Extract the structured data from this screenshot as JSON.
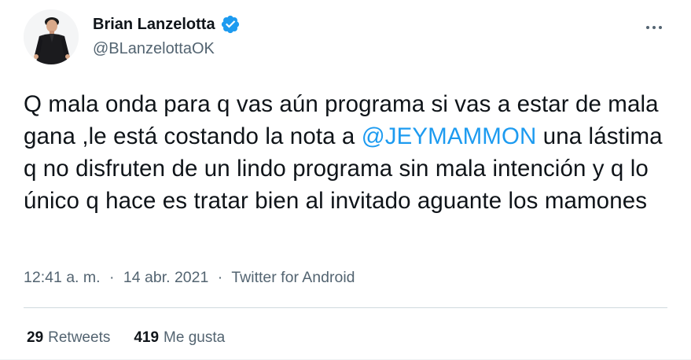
{
  "author": {
    "name": "Brian Lanzelotta",
    "handle": "@BLanzelottaOK",
    "verified": true
  },
  "tweet": {
    "text_before": "Q mala onda para q vas aún programa si vas a estar de mala gana ,le está costando la nota a ",
    "mention": "@JEYMAMMON",
    "text_after": " una lástima q no disfruten de un lindo programa sin mala intención y q lo único q hace es tratar bien al invitado aguante los mamones"
  },
  "meta": {
    "time": "12:41 a. m.",
    "date": "14 abr. 2021",
    "source": "Twitter for Android",
    "separator": "·"
  },
  "stats": {
    "retweets_count": "29",
    "retweets_label": "Retweets",
    "likes_count": "419",
    "likes_label": "Me gusta"
  },
  "icons": {
    "more": "more-options-icon",
    "verified": "verified-badge-icon"
  },
  "colors": {
    "link": "#1d9bf0",
    "secondary": "#536471",
    "primary": "#0f1419"
  }
}
